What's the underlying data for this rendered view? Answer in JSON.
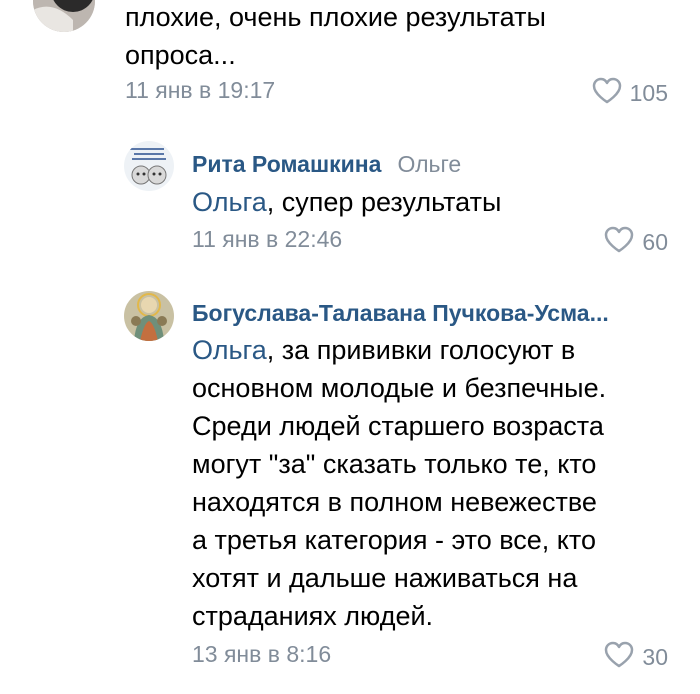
{
  "comments": [
    {
      "text_lines": [
        "плохие, очень плохие результаты",
        "опроса..."
      ],
      "date": "11 янв в 19:17",
      "likes": "105"
    },
    {
      "author": "Рита Ромашкина",
      "reply_to": "Ольге",
      "mention": "Ольга",
      "text_first": ", супер результаты",
      "date": "11 янв в 22:46",
      "likes": "60"
    },
    {
      "author": "Богуслава-Талавана Пучкова-Усма...",
      "mention": "Ольга",
      "text_first": ", за прививки голосуют в",
      "text_lines": [
        "основном молодые  и безпечные.",
        "Среди людей старшего возраста",
        "могут \"за\" сказать только те, кто",
        "находятся в полном невежестве",
        "а третья категория - это  все, кто",
        "хотят и дальше наживаться на",
        "страданиях людей."
      ],
      "date": "13 янв в 8:16",
      "likes": "30"
    }
  ],
  "colors": {
    "link": "#2a5885",
    "meta": "#818c99",
    "text": "#000000"
  },
  "icons": {
    "like": "heart-outline-icon"
  }
}
